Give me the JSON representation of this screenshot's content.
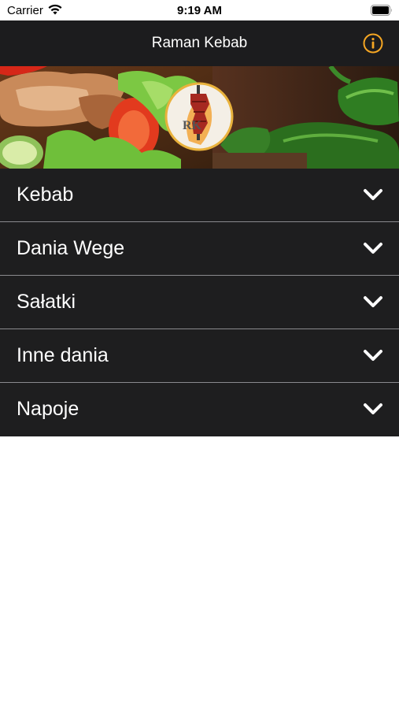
{
  "status_bar": {
    "carrier": "Carrier",
    "time": "9:19 AM",
    "wifi_icon": "wifi-icon",
    "battery_icon": "battery-icon"
  },
  "navbar": {
    "title": "Raman Kebab",
    "info_icon": "info-icon",
    "accent_color": "#f5a623",
    "background": "#1c1c1e"
  },
  "banner": {
    "logo_text": "RK",
    "description_icon": "kebab-logo"
  },
  "menu": {
    "items": [
      {
        "label": "Kebab",
        "icon": "chevron-down-icon"
      },
      {
        "label": "Dania Wege",
        "icon": "chevron-down-icon"
      },
      {
        "label": "Sałatki",
        "icon": "chevron-down-icon"
      },
      {
        "label": "Inne dania",
        "icon": "chevron-down-icon"
      },
      {
        "label": "Napoje",
        "icon": "chevron-down-icon"
      }
    ],
    "background": "#1e1e1f",
    "divider_color": "#8a8a8e"
  }
}
